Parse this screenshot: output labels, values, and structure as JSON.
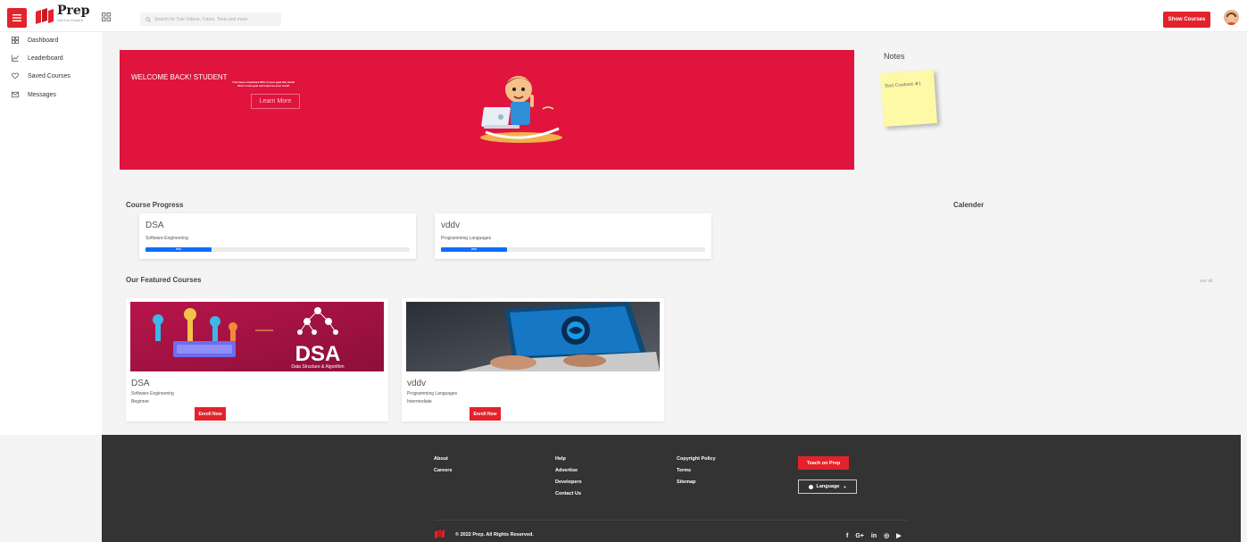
{
  "header": {
    "logo_name": "Prep",
    "logo_tagline": "Get it to Crack it",
    "search_placeholder": "Search for Tuts Videos, Tutors, Tests and more..",
    "show_courses_label": "Show Courses",
    "brand_color": "#e3222b"
  },
  "sidebar": {
    "items": [
      {
        "label": "Dashboard",
        "icon": "grid-icon"
      },
      {
        "label": "Leaderboard",
        "icon": "chart-line-icon"
      },
      {
        "label": "Saved Courses",
        "icon": "heart-icon"
      },
      {
        "label": "Messages",
        "icon": "mail-icon"
      }
    ]
  },
  "banner": {
    "welcome": "WELCOME BACK! STUDENT",
    "sub_line1": "Your have completed 60% of your goal this week!",
    "sub_line2": "Start a new goal and improve your result",
    "learn_more_label": "Learn More",
    "background": "#e0143c"
  },
  "notes": {
    "title": "Notes",
    "sticky_text": "Test Content #1"
  },
  "progress": {
    "title": "Course Progress",
    "calendar_title": "Calender",
    "cards": [
      {
        "name": "DSA",
        "category": "Software Engineering",
        "percent": 25,
        "percent_label": "25%"
      },
      {
        "name": "vddv",
        "category": "Programming Languages",
        "percent": 25,
        "percent_label": "25%"
      }
    ]
  },
  "featured": {
    "title": "Our Featured Courses",
    "see_all": "see all",
    "dsa_thumb_title": "DSA",
    "dsa_thumb_subtitle": "Data Structure & Algorithm",
    "cards": [
      {
        "name": "DSA",
        "category": "Software Engineering",
        "level": "Beginner",
        "enroll_label": "Enroll Now"
      },
      {
        "name": "vddv",
        "category": "Programming Languages",
        "level": "Intermediate",
        "enroll_label": "Enroll Now"
      }
    ]
  },
  "footer": {
    "col1": [
      "About",
      "Careers"
    ],
    "col2": [
      "Help",
      "Advertise",
      "Developers",
      "Contact Us"
    ],
    "col3": [
      "Copyright Policy",
      "Terms",
      "Sitemap"
    ],
    "teach_label": "Teach on Prep",
    "language_label": "Language",
    "copyright": "© 2022 Prep. All Rights Reserved.",
    "socials": [
      "f",
      "G+",
      "in",
      "◎",
      "▶"
    ]
  }
}
